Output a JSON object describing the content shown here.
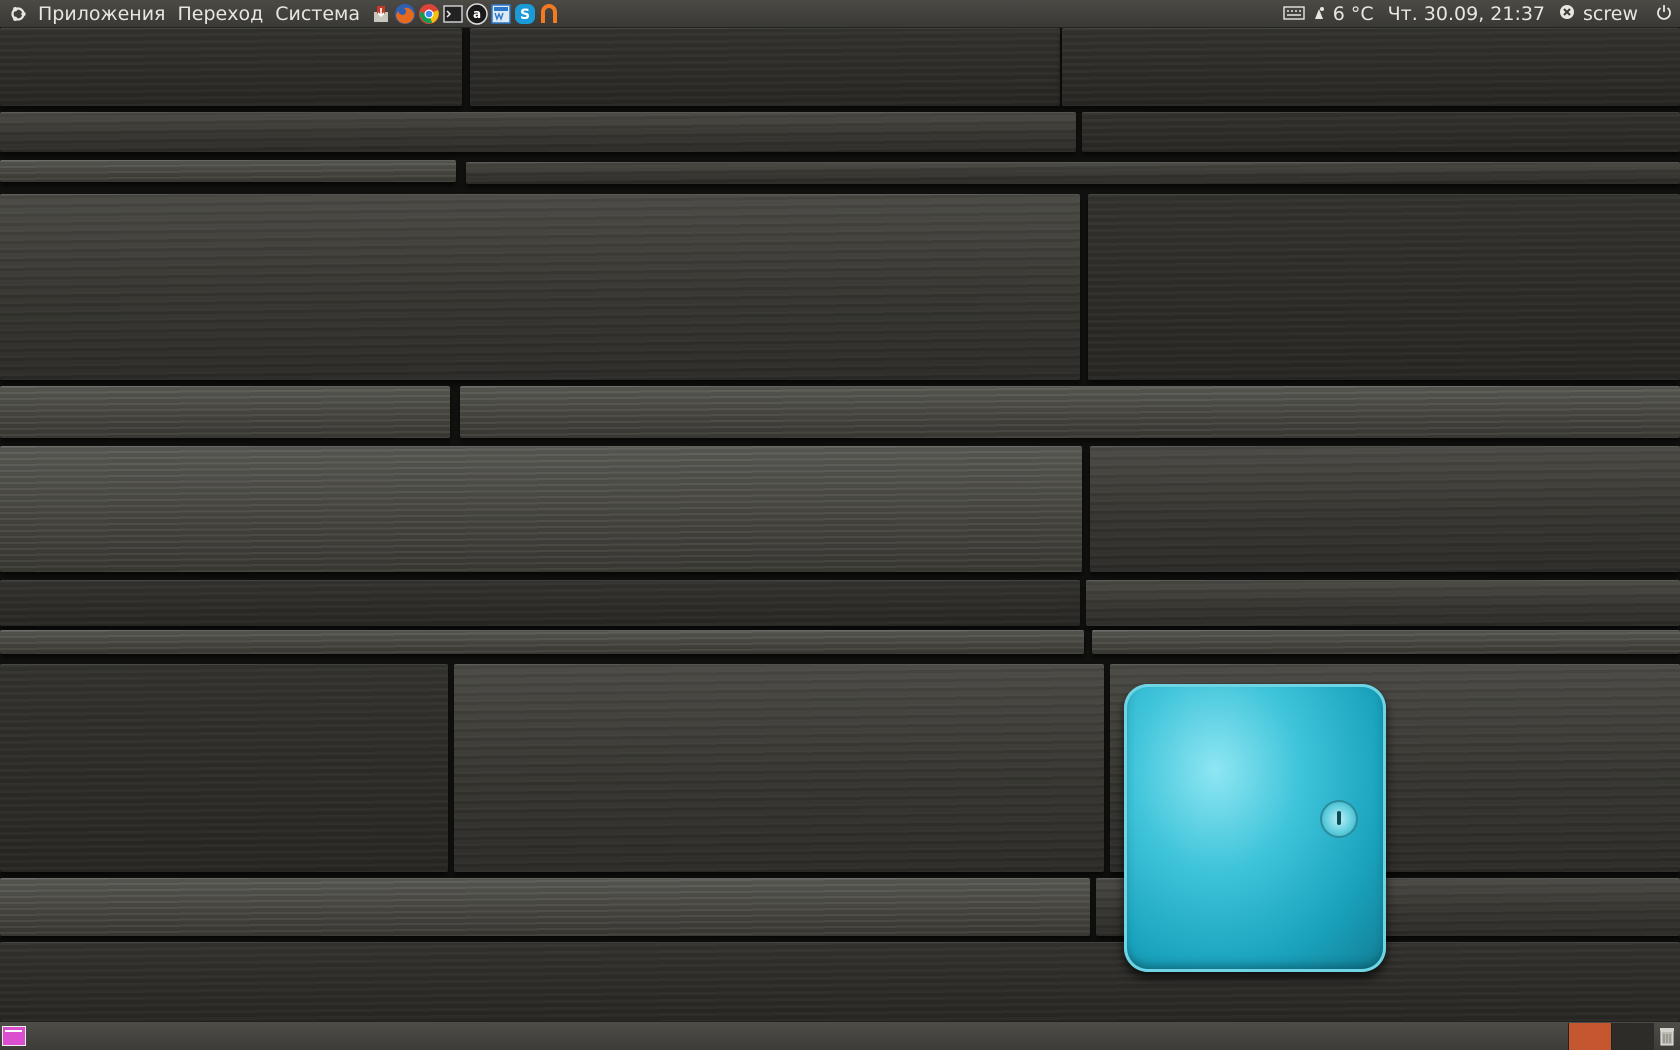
{
  "top_panel": {
    "menus": [
      "Приложения",
      "Переход",
      "Система"
    ],
    "launchers": [
      {
        "name": "install-icon",
        "color": "#c23a2b"
      },
      {
        "name": "firefox-icon",
        "color": "#e66a1e"
      },
      {
        "name": "chrome-icon",
        "color": "#3c8ee6"
      },
      {
        "name": "terminal-icon",
        "color": "#222222"
      },
      {
        "name": "aimp-icon",
        "color": "#1a1a1a"
      },
      {
        "name": "writer-icon",
        "color": "#2c78c8"
      },
      {
        "name": "skype-icon",
        "color": "#1a9ad6"
      },
      {
        "name": "ubuntu-one-icon",
        "color": "#f27a22"
      }
    ],
    "tray": {
      "weather": "6 °C",
      "datetime": "Чт. 30.09, 21:37",
      "user": "screw"
    }
  },
  "colors": {
    "accent_workspace": "#c4572f",
    "box_cyan": "#2fb8d0"
  }
}
